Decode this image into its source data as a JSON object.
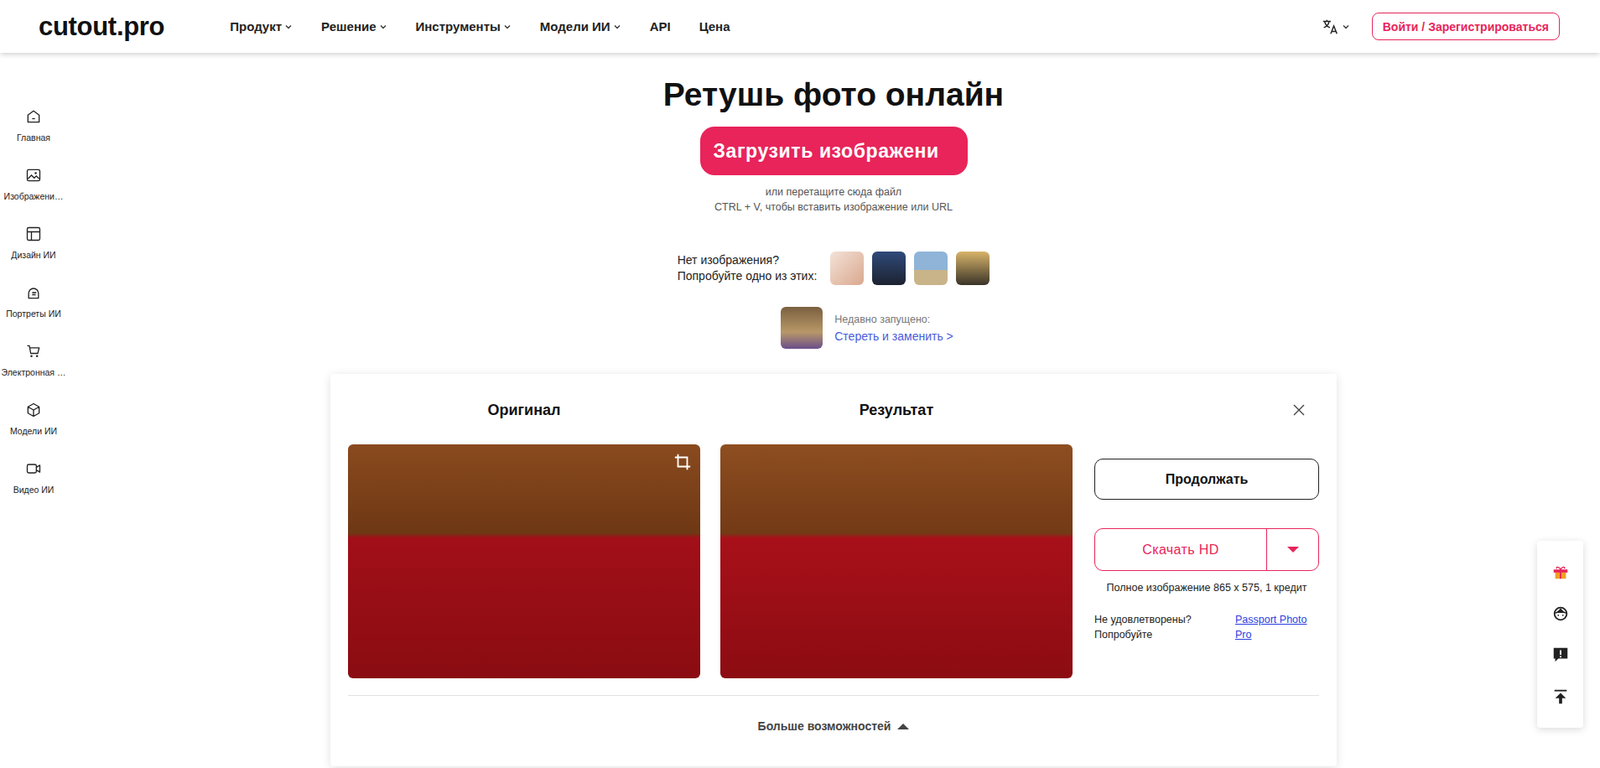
{
  "header": {
    "logo": "cutout.pro",
    "nav": [
      {
        "label": "Продукт",
        "dropdown": true
      },
      {
        "label": "Решение",
        "dropdown": true
      },
      {
        "label": "Инструменты",
        "dropdown": true
      },
      {
        "label": "Модели ИИ",
        "dropdown": true
      },
      {
        "label": "API",
        "dropdown": false
      },
      {
        "label": "Цена",
        "dropdown": false
      }
    ],
    "login_button": "Войти / Зарегистрироваться"
  },
  "sidebar": {
    "items": [
      {
        "label": "Главная",
        "selected": false
      },
      {
        "label": "Изображени…",
        "selected": false
      },
      {
        "label": "Дизайн ИИ",
        "selected": false
      },
      {
        "label": "Портреты ИИ",
        "selected": false
      },
      {
        "label": "Электронная …",
        "selected": false
      },
      {
        "label": "Модели ИИ",
        "selected": false
      },
      {
        "label": "Видео ИИ",
        "selected": false
      }
    ]
  },
  "hero": {
    "title": "Ретушь фото онлайн",
    "upload_button": "Загрузить изображени",
    "drop_hint": "или перетащите сюда файл",
    "paste_hint": "CTRL + V, чтобы вставить изображение или URL",
    "samples_label": [
      "Нет изображения?",
      "Попробуйте одно из этих:"
    ],
    "recent_label": "Недавно запущено:",
    "recent_link": "Стереть и заменить >"
  },
  "result_card": {
    "original_label": "Оригинал",
    "result_label": "Результат",
    "continue_button": "Продолжать",
    "download_button": "Скачать HD",
    "image_info": "Полное изображение 865 x 575, 1 кредит",
    "unsatisfied": [
      "Не удовлетворены?",
      "Попробуйте"
    ],
    "alternative_link": "Passport Photo Pro",
    "more": "Больше возможностей"
  }
}
